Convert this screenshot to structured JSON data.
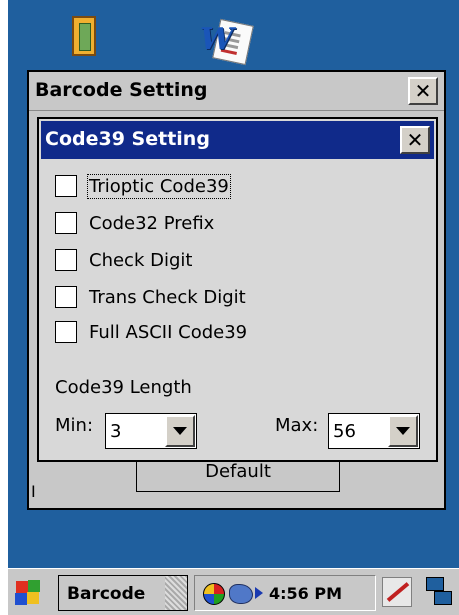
{
  "outer_dialog": {
    "title": "Barcode Setting",
    "close_label": "✕",
    "default_button": "Default"
  },
  "inner_dialog": {
    "title": "Code39 Setting",
    "close_label": "✕",
    "options": [
      {
        "label": "Trioptic Code39",
        "checked": false
      },
      {
        "label": "Code32 Prefix",
        "checked": false
      },
      {
        "label": "Check Digit",
        "checked": false
      },
      {
        "label": "Trans Check Digit",
        "checked": false
      },
      {
        "label": "Full ASCII Code39",
        "checked": false
      }
    ],
    "length_label": "Code39 Length",
    "min_label": "Min:",
    "min_value": "3",
    "max_label": "Max:",
    "max_value": "56"
  },
  "taskbar": {
    "task_label": "Barcode",
    "time": "4:56 PM"
  },
  "background": {
    "edge_char": "I"
  },
  "colors": {
    "desktop": "#1f5f9e",
    "titlebar_active": "#102a8a",
    "dialog_bg": "#d8d8d8"
  },
  "icons": [
    "app-icon",
    "word-document-icon",
    "start-flag-icon",
    "network-icon",
    "connection-icon",
    "pen-input-icon",
    "window-switch-icon"
  ]
}
